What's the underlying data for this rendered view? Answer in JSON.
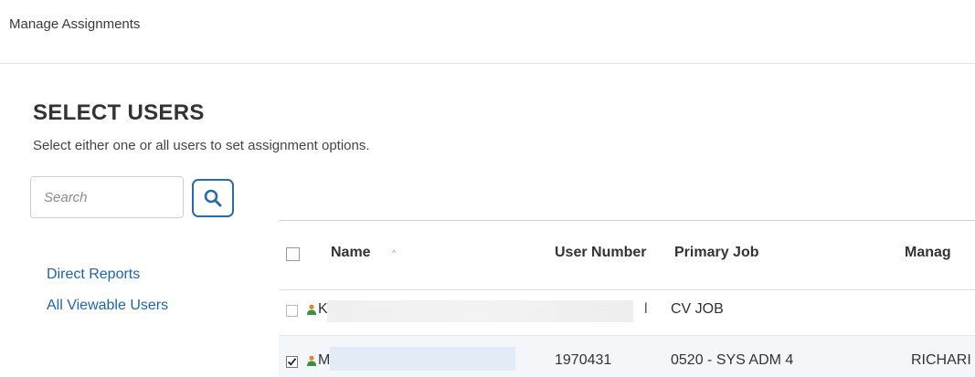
{
  "page": {
    "title": "Manage Assignments"
  },
  "section": {
    "heading": "SELECT USERS",
    "description": "Select either one or all users to set assignment options."
  },
  "search": {
    "placeholder": "Search"
  },
  "icons": {
    "search": "search-icon",
    "user": "user-icon"
  },
  "colors": {
    "link": "#1f64a8",
    "search_border": "#2a6aa6",
    "user_icon_head": "#d98a2b",
    "user_icon_body": "#3e8e3e"
  },
  "nav": {
    "direct_reports": "Direct Reports",
    "all_viewable": "All Viewable Users"
  },
  "table": {
    "columns": {
      "name": "Name",
      "user_number": "User Number",
      "primary_job": "Primary Job",
      "manager": "Manag"
    },
    "sort_indicator": "^",
    "rows": [
      {
        "checked": false,
        "name_initial": "K",
        "user_number": "l",
        "primary_job": "CV JOB",
        "manager": ""
      },
      {
        "checked": true,
        "name_initial": "M",
        "user_number": "1970431",
        "primary_job": "0520 - SYS ADM 4",
        "manager": "RICHARI"
      }
    ]
  }
}
